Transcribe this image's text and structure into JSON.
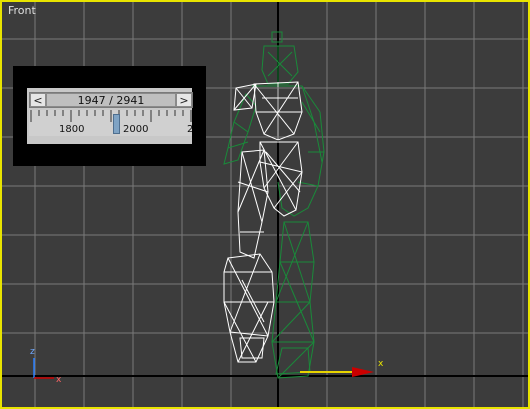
{
  "viewport": {
    "label": "Front",
    "border_color": "#e8e400",
    "grid_color": "#7a7a7a",
    "axis_line_color": "#000000"
  },
  "time_slider": {
    "prev_icon": "chevron-left-icon",
    "prev_label": "<",
    "next_icon": "chevron-right-icon",
    "next_label": ">",
    "frame_text": "1947 / 2941",
    "ruler_labels": [
      "1800",
      "2000",
      "2"
    ]
  },
  "axis_gizmo": {
    "x_label": "x",
    "z_label": "z",
    "x_color": "#cc0000",
    "z_color": "#2a7fff"
  },
  "figure": {
    "selected_color": "#ffffff",
    "unselected_color": "#1a8a3a"
  }
}
